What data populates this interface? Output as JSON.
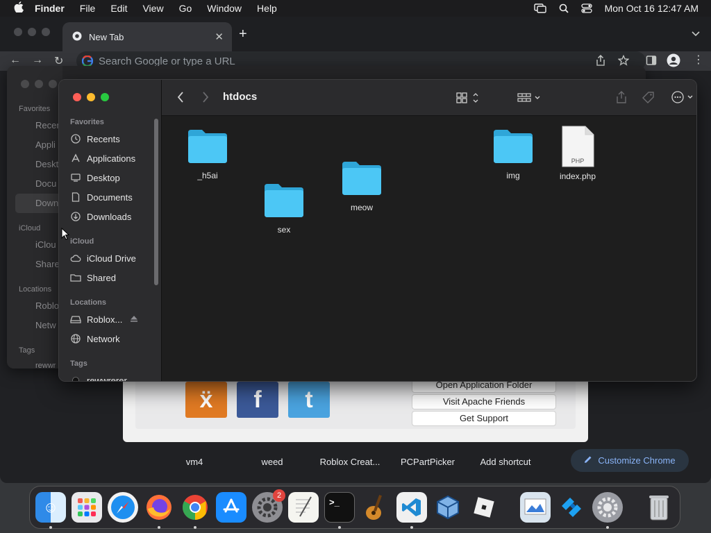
{
  "menubar": {
    "app": "Finder",
    "items": [
      "File",
      "Edit",
      "View",
      "Go",
      "Window",
      "Help"
    ],
    "clock": "Mon Oct 16  12:47 AM"
  },
  "chrome": {
    "tab_title": "New Tab",
    "omnibox_placeholder": "Search Google or type a URL",
    "shortcuts": [
      "vm4",
      "weed",
      "Roblox Creat...",
      "PCPartPicker",
      "Add shortcut"
    ],
    "customize_label": "Customize Chrome",
    "xampp_buttons": [
      "Open Application Folder",
      "Visit Apache Friends",
      "Get Support"
    ]
  },
  "ghost_finder": {
    "headers": [
      "Favorites",
      "iCloud",
      "Locations",
      "Tags"
    ],
    "items": [
      "Recen",
      "Appli",
      "Deskt",
      "Docu",
      "Down",
      "iClou",
      "Share",
      "Roblo",
      "Netw",
      "rewwr"
    ]
  },
  "finder": {
    "title": "htdocs",
    "sidebar": {
      "favorites_header": "Favorites",
      "favorites": [
        "Recents",
        "Applications",
        "Desktop",
        "Documents",
        "Downloads"
      ],
      "icloud_header": "iCloud",
      "icloud": [
        "iCloud Drive",
        "Shared"
      ],
      "locations_header": "Locations",
      "locations": [
        "Roblox...",
        "Network"
      ],
      "tags_header": "Tags",
      "tags": [
        "rewwrerer"
      ]
    },
    "items": [
      {
        "name": "_h5ai",
        "kind": "folder"
      },
      {
        "name": "sex",
        "kind": "folder"
      },
      {
        "name": "meow",
        "kind": "folder"
      },
      {
        "name": "img",
        "kind": "folder"
      },
      {
        "name": "index.php",
        "kind": "php-file",
        "badge": "PHP"
      }
    ]
  },
  "dock": {
    "apps": [
      "Finder",
      "Launchpad",
      "Safari",
      "Firefox",
      "Google Chrome",
      "App Store",
      "System Preferences",
      "TextEdit",
      "Terminal",
      "GarageBand",
      "Visual Studio Code",
      "VirtualBox",
      "Roblox",
      "Preview",
      "Roblox Studio",
      "Settings",
      "Trash"
    ],
    "settings_badge": "2"
  },
  "colors": {
    "folder": "#3ec0f0",
    "accent_link": "#8ab4f8",
    "close": "#ff5f57",
    "minimize": "#febc2e",
    "zoom": "#28c840"
  }
}
